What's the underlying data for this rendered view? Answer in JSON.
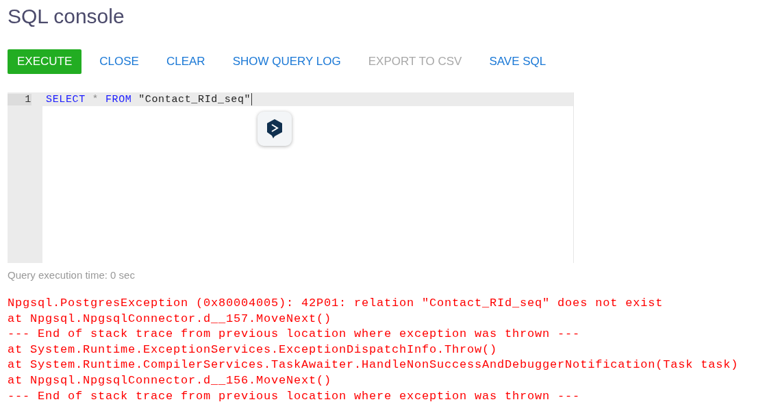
{
  "title": "SQL console",
  "toolbar": [
    {
      "label": "EXECUTE",
      "kind": "primary",
      "disabled": false
    },
    {
      "label": "CLOSE",
      "kind": "link",
      "disabled": false
    },
    {
      "label": "CLEAR",
      "kind": "link",
      "disabled": false
    },
    {
      "label": "SHOW QUERY LOG",
      "kind": "link",
      "disabled": false
    },
    {
      "label": "EXPORT TO CSV",
      "kind": "link",
      "disabled": true
    },
    {
      "label": "SAVE SQL",
      "kind": "link",
      "disabled": false
    }
  ],
  "editor": {
    "lines": [
      {
        "number": "1",
        "tokens": [
          {
            "text": "SELECT",
            "kind": "keyword"
          },
          {
            "text": "*",
            "kind": "operator"
          },
          {
            "text": "FROM",
            "kind": "keyword"
          },
          {
            "text": "\"Contact_RId_seq\"",
            "kind": "string"
          }
        ]
      }
    ]
  },
  "execution_time": "Query execution time: 0 sec",
  "error_lines": [
    "Npgsql.PostgresException (0x80004005): 42P01: relation \"Contact_RId_seq\" does not exist",
    "at Npgsql.NpgsqlConnector.d__157.MoveNext()",
    "--- End of stack trace from previous location where exception was thrown ---",
    "at System.Runtime.ExceptionServices.ExceptionDispatchInfo.Throw()",
    "at System.Runtime.CompilerServices.TaskAwaiter.HandleNonSuccessAndDebuggerNotification(Task task)",
    "at Npgsql.NpgsqlConnector.d__156.MoveNext()",
    "--- End of stack trace from previous location where exception was thrown ---"
  ]
}
